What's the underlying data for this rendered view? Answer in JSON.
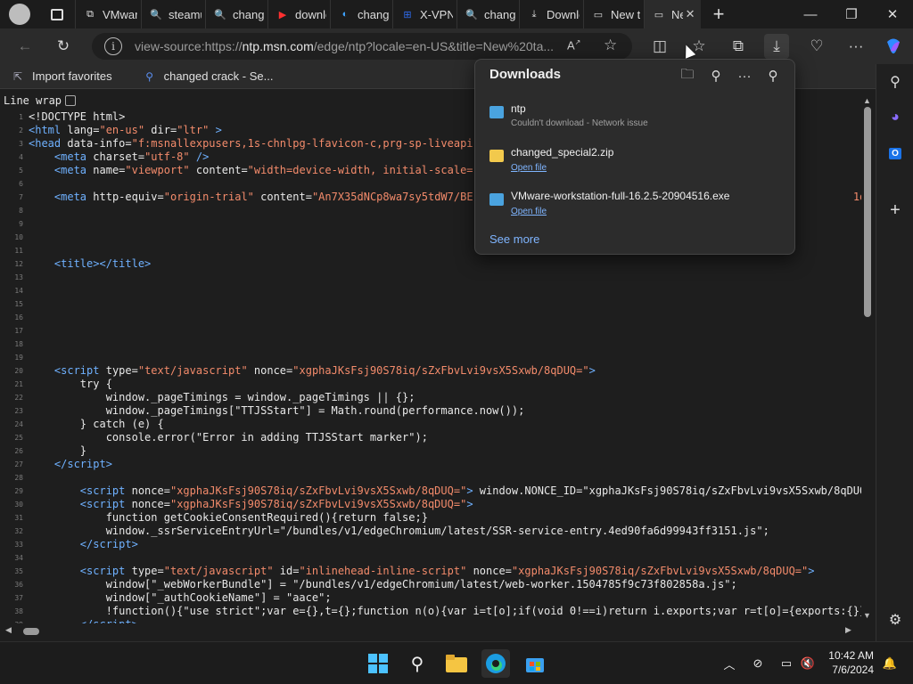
{
  "tabs": [
    {
      "label": "VMwar",
      "icon": "vmware-icon",
      "color": "#e8e8e8",
      "glyph": "⧉"
    },
    {
      "label": "steamu",
      "icon": "search-icon",
      "color": "#5a8dee",
      "glyph": "🔍"
    },
    {
      "label": "change",
      "icon": "search-icon",
      "color": "#5a8dee",
      "glyph": "🔍"
    },
    {
      "label": "downlc",
      "icon": "youtube-icon",
      "color": "#ff3030",
      "glyph": "▶"
    },
    {
      "label": "change",
      "icon": "edge-icon",
      "color": "#3fa3ff",
      "glyph": "◐"
    },
    {
      "label": "X-VPN",
      "icon": "xvpn-icon",
      "color": "#2f6cf0",
      "glyph": "⊞"
    },
    {
      "label": "change",
      "icon": "search-icon",
      "color": "#5a8dee",
      "glyph": "🔍"
    },
    {
      "label": "Downlc",
      "icon": "download-icon",
      "color": "#dddddd",
      "glyph": "⤓"
    },
    {
      "label": "New ta",
      "icon": "newtab-icon",
      "color": "#dddddd",
      "glyph": "▭"
    },
    {
      "label": "Ne",
      "icon": "newtab-icon",
      "color": "#dddddd",
      "glyph": "▭",
      "active": true
    }
  ],
  "address": {
    "prefix": "view-source:https://",
    "host": "ntp.msn.com",
    "path": "/edge/ntp?locale=en-US&title=New%20ta..."
  },
  "favorites": [
    {
      "label": "Import favorites",
      "icon": "import-favorites-icon"
    },
    {
      "label": "changed crack - Se...",
      "icon": "search-icon"
    }
  ],
  "viewsource": {
    "linewrap_label": "Line wrap",
    "lines": [
      {
        "n": "1",
        "html": "<span class='attr'>&lt;!DOCTYPE html&gt;</span>"
      },
      {
        "n": "2",
        "html": "<span class='tag'>&lt;html</span> <span class='attr'>lang=</span><span class='val'>\"en-us\"</span> <span class='attr'>dir=</span><span class='val'>\"ltr\"</span> <span class='tag'>&gt;</span>"
      },
      {
        "n": "3",
        "html": "<span class='tag'>&lt;head</span> <span class='attr'>data-info=</span><span class='val'>\"f:msnallexpusers,1s-chnlpg-lfavicon-c,prg-sp-liveapi</span>                                                                   <span class='val'>cm-pollai-c</span>"
      },
      {
        "n": "4",
        "html": "    <span class='tag'>&lt;meta</span> <span class='attr'>charset=</span><span class='val'>\"utf-8\"</span> <span class='tag'>/&gt;</span>"
      },
      {
        "n": "5",
        "html": "    <span class='tag'>&lt;meta</span> <span class='attr'>name=</span><span class='val'>\"viewport\"</span> <span class='attr'>content=</span><span class='val'>\"width=device-width, initial-scale=</span>"
      },
      {
        "n": "6",
        "html": ""
      },
      {
        "n": "7",
        "html": "    <span class='tag'>&lt;meta</span> <span class='attr'>http-equiv=</span><span class='val'>\"origin-trial\"</span> <span class='attr'>content=</span><span class='val'>\"An7X35dNCp8wa7sy5tdW7/BE</span>                                                           <span class='val'>1q1w+N2MF2</span>"
      },
      {
        "n": "8",
        "html": ""
      },
      {
        "n": "9",
        "html": ""
      },
      {
        "n": "10",
        "html": ""
      },
      {
        "n": "11",
        "html": ""
      },
      {
        "n": "12",
        "html": "    <span class='tag'>&lt;title&gt;&lt;/title&gt;</span>"
      },
      {
        "n": "13",
        "html": ""
      },
      {
        "n": "14",
        "html": ""
      },
      {
        "n": "15",
        "html": ""
      },
      {
        "n": "16",
        "html": ""
      },
      {
        "n": "17",
        "html": ""
      },
      {
        "n": "18",
        "html": ""
      },
      {
        "n": "19",
        "html": ""
      },
      {
        "n": "20",
        "html": "    <span class='tag'>&lt;script</span> <span class='attr'>type=</span><span class='val'>\"text/javascript\"</span> <span class='attr'>nonce=</span><span class='val'>\"xgphaJKsFsj90S78iq/sZxFbvLvi9vsX5Sxwb/8qDUQ=\"</span><span class='tag'>&gt;</span>"
      },
      {
        "n": "21",
        "html": "        try {"
      },
      {
        "n": "22",
        "html": "            window._pageTimings = window._pageTimings || {};"
      },
      {
        "n": "23",
        "html": "            window._pageTimings[\"TTJSStart\"] = Math.round(performance.now());"
      },
      {
        "n": "24",
        "html": "        } catch (e) {"
      },
      {
        "n": "25",
        "html": "            console.error(\"Error in adding TTJSStart marker\");"
      },
      {
        "n": "26",
        "html": "        }"
      },
      {
        "n": "27",
        "html": "    <span class='tag'>&lt;/script&gt;</span>"
      },
      {
        "n": "28",
        "html": ""
      },
      {
        "n": "29",
        "html": "        <span class='tag'>&lt;script</span> <span class='attr'>nonce=</span><span class='val'>\"xgphaJKsFsj90S78iq/sZxFbvLvi9vsX5Sxwb/8qDUQ=\"</span><span class='tag'>&gt;</span> window.NONCE_ID=\"xgphaJKsFsj90S78iq/sZxFbvLvi9vsX5Sxwb/8qDUQ"
      },
      {
        "n": "30",
        "html": "        <span class='tag'>&lt;script</span> <span class='attr'>nonce=</span><span class='val'>\"xgphaJKsFsj90S78iq/sZxFbvLvi9vsX5Sxwb/8qDUQ=\"</span><span class='tag'>&gt;</span>"
      },
      {
        "n": "31",
        "html": "            function getCookieConsentRequired(){return false;}"
      },
      {
        "n": "32",
        "html": "            window._ssrServiceEntryUrl=\"/bundles/v1/edgeChromium/latest/SSR-service-entry.4ed90fa6d99943ff3151.js\";"
      },
      {
        "n": "33",
        "html": "        <span class='tag'>&lt;/script&gt;</span>"
      },
      {
        "n": "34",
        "html": ""
      },
      {
        "n": "35",
        "html": "        <span class='tag'>&lt;script</span> <span class='attr'>type=</span><span class='val'>\"text/javascript\"</span> <span class='attr'>id=</span><span class='val'>\"inlinehead-inline-script\"</span> <span class='attr'>nonce=</span><span class='val'>\"xgphaJKsFsj90S78iq/sZxFbvLvi9vsX5Sxwb/8qDUQ=\"</span><span class='tag'>&gt;</span>"
      },
      {
        "n": "36",
        "html": "            window[\"_webWorkerBundle\"] = \"/bundles/v1/edgeChromium/latest/web-worker.1504785f9c73f802858a.js\";"
      },
      {
        "n": "37",
        "html": "            window[\"_authCookieName\"] = \"aace\";"
      },
      {
        "n": "38",
        "html": "            !function(){\"use strict\";var e={},t={};function n(o){var i=t[o];if(void 0!==i)return i.exports;var r=t[o]={exports:{}}"
      },
      {
        "n": "39",
        "html": "        <span class='tag'>&lt;/script&gt;</span>"
      }
    ]
  },
  "downloads": {
    "title": "Downloads",
    "items": [
      {
        "name": "ntp",
        "sub": "Couldn't download - Network issue",
        "link": "",
        "icon": "failed-file-icon",
        "color": "#4aa3df"
      },
      {
        "name": "changed_special2.zip",
        "sub": "",
        "link": "Open file",
        "icon": "zip-folder-icon",
        "color": "#f2c94c"
      },
      {
        "name": "VMware-workstation-full-16.2.5-20904516.exe",
        "sub": "",
        "link": "Open file",
        "icon": "exe-file-icon",
        "color": "#4aa3df"
      }
    ],
    "see_more": "See more"
  },
  "clock": {
    "time": "10:42 AM",
    "date": "7/6/2024"
  },
  "colors": {
    "accent": "#7fb5ff",
    "tag": "#6fb1ff",
    "value": "#f38b6b"
  }
}
